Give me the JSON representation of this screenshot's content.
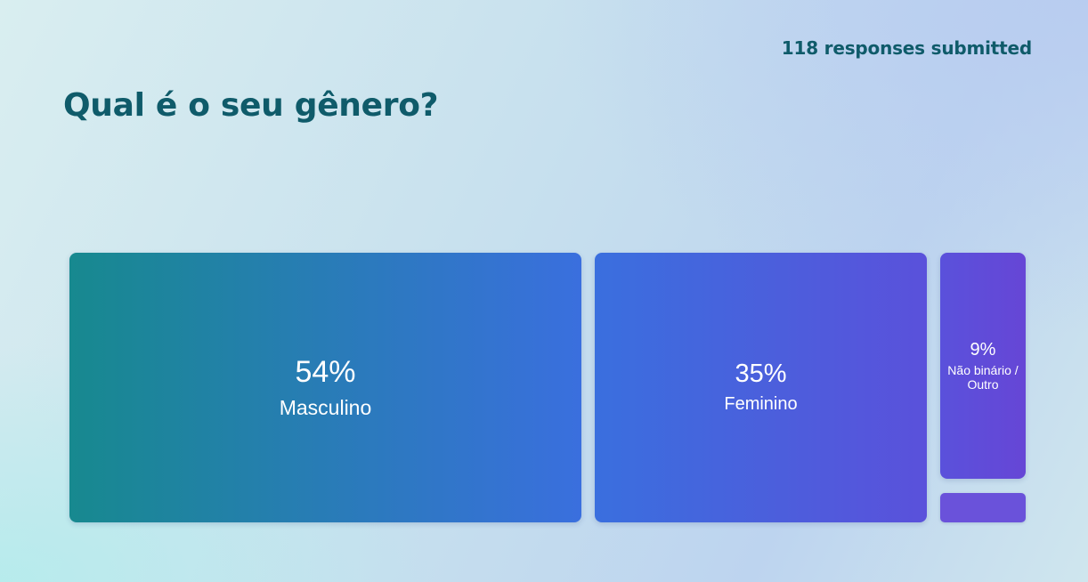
{
  "header": {
    "responses": "118 responses submitted"
  },
  "question": {
    "title": "Qual é o seu gênero?"
  },
  "chart_data": {
    "type": "bar",
    "categories": [
      "Masculino",
      "Feminino",
      "Não binário / Outro",
      ""
    ],
    "values": [
      54,
      35,
      9,
      2
    ],
    "value_labels": [
      "54%",
      "35%",
      "9%",
      ""
    ],
    "unit": "%"
  },
  "colors": {
    "teal": "#17898f",
    "blue": "#3a6fde",
    "violet": "#5a51db",
    "purple": "#6646d6"
  }
}
